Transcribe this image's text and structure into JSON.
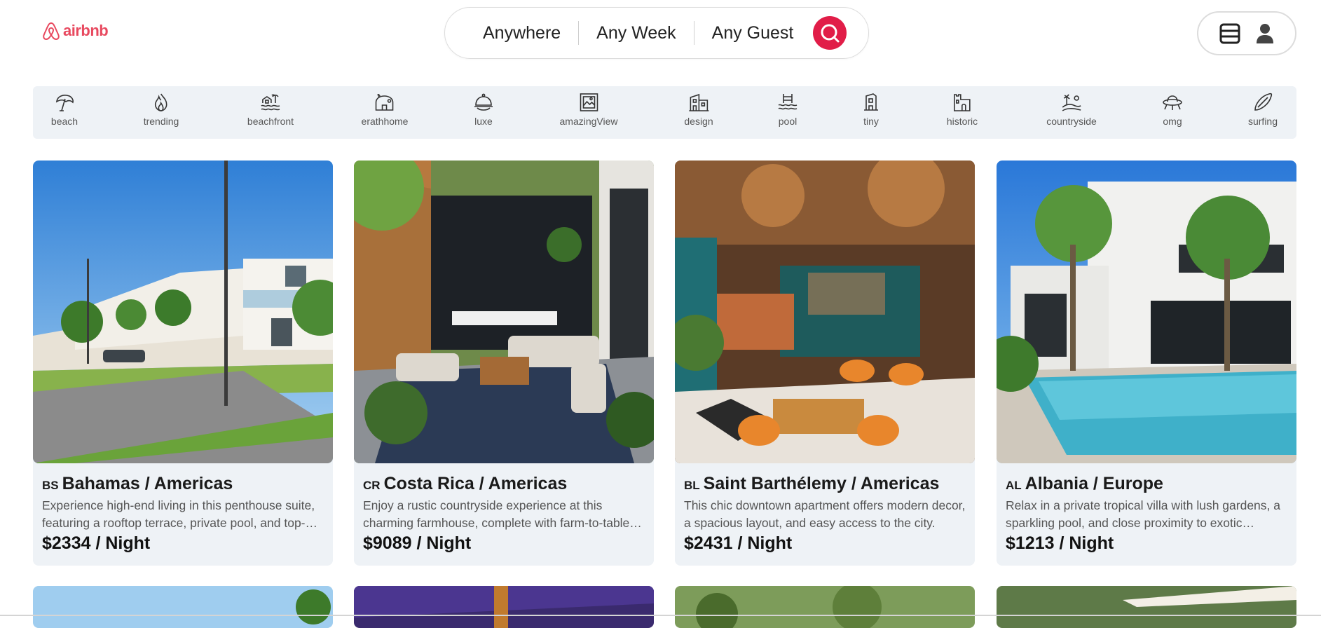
{
  "header": {
    "logo_text": "airbnb",
    "search": {
      "anywhere": "Anywhere",
      "week": "Any Week",
      "guest": "Any Guest"
    }
  },
  "categories": [
    {
      "label": "beach",
      "icon": "beach-umbrella-icon"
    },
    {
      "label": "trending",
      "icon": "flame-icon"
    },
    {
      "label": "beachfront",
      "icon": "beachfront-icon"
    },
    {
      "label": "erathhome",
      "icon": "earth-home-icon"
    },
    {
      "label": "luxe",
      "icon": "luxe-icon"
    },
    {
      "label": "amazingView",
      "icon": "picture-frame-icon"
    },
    {
      "label": "design",
      "icon": "design-building-icon"
    },
    {
      "label": "pool",
      "icon": "pool-icon"
    },
    {
      "label": "tiny",
      "icon": "tiny-home-icon"
    },
    {
      "label": "historic",
      "icon": "historic-castle-icon"
    },
    {
      "label": "countryside",
      "icon": "countryside-icon"
    },
    {
      "label": "omg",
      "icon": "ufo-icon"
    },
    {
      "label": "surfing",
      "icon": "surfboard-icon"
    }
  ],
  "listings": [
    {
      "code": "BS",
      "title": "Bahamas / Americas",
      "desc": "Experience high-end living in this penthouse suite, featuring a rooftop terrace, private pool, and top-notch amenities.",
      "price": "$2334 / Night"
    },
    {
      "code": "CR",
      "title": "Costa Rica / Americas",
      "desc": "Enjoy a rustic countryside experience at this charming farmhouse, complete with farm-to-table dining.",
      "price": "$9089 / Night"
    },
    {
      "code": "BL",
      "title": "Saint Barthélemy / Americas",
      "desc": "This chic downtown apartment offers modern decor, a spacious layout, and easy access to the city.",
      "price": "$2431 / Night"
    },
    {
      "code": "AL",
      "title": "Albania / Europe",
      "desc": "Relax in a private tropical villa with lush gardens, a sparkling pool, and close proximity to exotic beaches.",
      "price": "$1213 / Night"
    }
  ],
  "colors": {
    "brand": "#e8495f",
    "search_button": "#e11d48",
    "card_bg": "#eef2f6"
  }
}
